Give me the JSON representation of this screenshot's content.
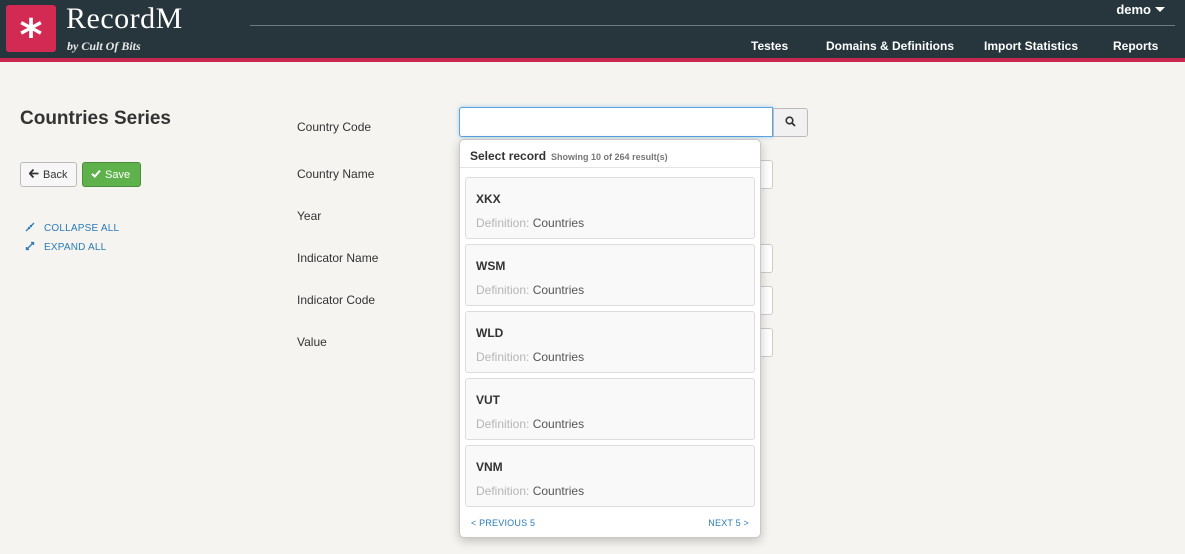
{
  "app": {
    "brand": "RecordM",
    "byline": "by Cult Of Bits",
    "logo_glyph": "*"
  },
  "user": {
    "name": "demo"
  },
  "nav": {
    "items": [
      "Testes",
      "Domains & Definitions",
      "Import Statistics",
      "Reports"
    ]
  },
  "page": {
    "title": "Countries Series"
  },
  "actions": {
    "back_label": "Back",
    "save_label": "Save",
    "collapse_label": "COLLAPSE ALL",
    "expand_label": "EXPAND ALL"
  },
  "form": {
    "labels": [
      "Country Code",
      "Country Name",
      "Year",
      "Indicator Name",
      "Indicator Code",
      "Value"
    ],
    "country_code_value": ""
  },
  "popup": {
    "title": "Select record",
    "count": "Showing 10 of 264 result(s)",
    "definition_key": "Definition:",
    "records": [
      {
        "code": "XKX",
        "definition": "Countries"
      },
      {
        "code": "WSM",
        "definition": "Countries"
      },
      {
        "code": "WLD",
        "definition": "Countries"
      },
      {
        "code": "VUT",
        "definition": "Countries"
      },
      {
        "code": "VNM",
        "definition": "Countries"
      }
    ],
    "prev_label": "< PREVIOUS 5",
    "next_label": "NEXT 5 >"
  },
  "colors": {
    "header_bg": "#26363c",
    "accent": "#c8264d",
    "save_green": "#5fb24b",
    "link_blue": "#2a7bb8"
  },
  "icons": {
    "search": "search-icon",
    "back": "arrow-left-icon",
    "save": "check-icon",
    "collapse": "compress-icon",
    "expand": "expand-icon"
  }
}
